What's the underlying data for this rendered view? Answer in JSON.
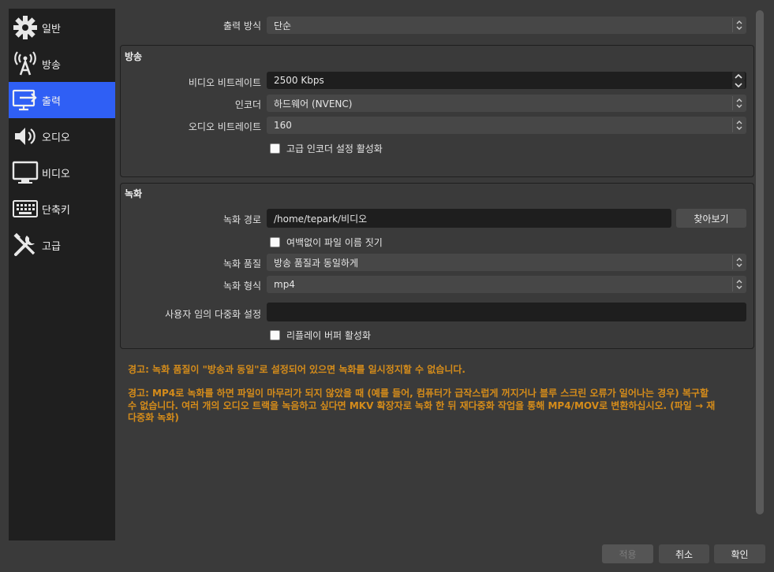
{
  "sidebar": {
    "items": [
      {
        "label": "일반",
        "icon": "gear-icon"
      },
      {
        "label": "방송",
        "icon": "broadcast-antenna-icon"
      },
      {
        "label": "출력",
        "icon": "output-monitor-icon"
      },
      {
        "label": "오디오",
        "icon": "speaker-icon"
      },
      {
        "label": "비디오",
        "icon": "monitor-icon"
      },
      {
        "label": "단축키",
        "icon": "keyboard-icon"
      },
      {
        "label": "고급",
        "icon": "tools-icon"
      }
    ],
    "active_index": 2,
    "active_color": "#2f5ff5"
  },
  "output_mode": {
    "label": "출력 방식",
    "value": "단순"
  },
  "streaming": {
    "title": "방송",
    "video_bitrate": {
      "label": "비디오 비트레이트",
      "value": "2500 Kbps"
    },
    "encoder": {
      "label": "인코더",
      "value": "하드웨어 (NVENC)"
    },
    "audio_bitrate": {
      "label": "오디오 비트레이트",
      "value": "160"
    },
    "advanced_encoder": {
      "label": "고급 인코더 설정 활성화",
      "checked": false
    }
  },
  "recording": {
    "title": "녹화",
    "path": {
      "label": "녹화 경로",
      "value": "/home/tepark/비디오",
      "browse": "찾아보기"
    },
    "no_space_filename": {
      "label": "여백없이 파일 이름 짓기",
      "checked": false
    },
    "quality": {
      "label": "녹화 품질",
      "value": "방송 품질과 동일하게"
    },
    "format": {
      "label": "녹화 형식",
      "value": "mp4"
    },
    "custom_muxer": {
      "label": "사용자 임의 다중화 설정",
      "value": ""
    },
    "replay_buffer": {
      "label": "리플레이 버퍼 활성화",
      "checked": false
    }
  },
  "warnings": {
    "w1": "경고: 녹화 품질이 \"방송과 동일\"로 설정되어 있으면 녹화를 일시정지할 수 없습니다.",
    "w2_line1": "경고: MP4로 녹화를 하면 파일이 마무리가 되지 않았을 때 (예를 들어, 컴퓨터가 급작스럽게 꺼지거나 블루 스크린 오류가 일어나는 경우) 복구할",
    "w2_line2": "수 없습니다. 여러 개의 오디오 트랙을 녹음하고 싶다면 MKV 확장자로 녹화 한 뒤 재다중화 작업을 통해 MP4/MOV로 변환하십시오. (파일 → 재",
    "w2_line3": "다중화 녹화)",
    "color": "#d58c1a"
  },
  "footer": {
    "apply": "적용",
    "cancel": "취소",
    "ok": "확인"
  }
}
